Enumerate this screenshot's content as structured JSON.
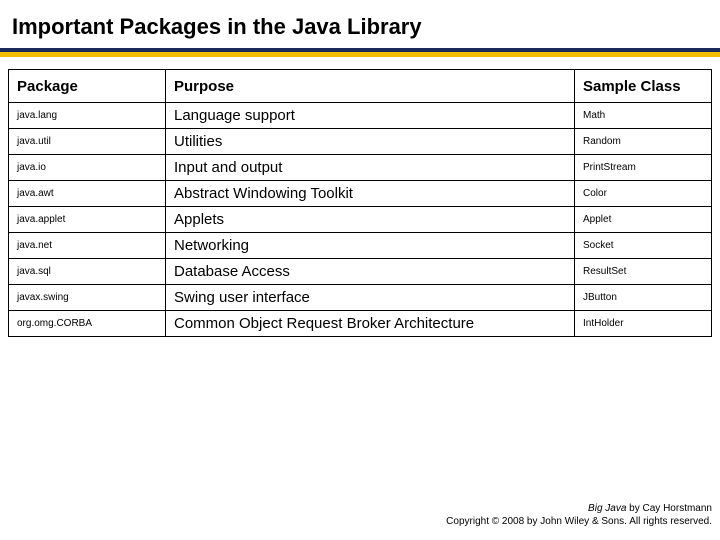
{
  "title": "Important Packages in the Java Library",
  "headers": {
    "package": "Package",
    "purpose": "Purpose",
    "sample": "Sample Class"
  },
  "rows": [
    {
      "pkg": "java.lang",
      "purpose": "Language support",
      "sample": "Math"
    },
    {
      "pkg": "java.util",
      "purpose": "Utilities",
      "sample": "Random"
    },
    {
      "pkg": "java.io",
      "purpose": "Input and output",
      "sample": "PrintStream"
    },
    {
      "pkg": "java.awt",
      "purpose": "Abstract Windowing Toolkit",
      "sample": "Color"
    },
    {
      "pkg": "java.applet",
      "purpose": "Applets",
      "sample": "Applet"
    },
    {
      "pkg": "java.net",
      "purpose": "Networking",
      "sample": "Socket"
    },
    {
      "pkg": "java.sql",
      "purpose": "Database Access",
      "sample": "ResultSet"
    },
    {
      "pkg": "javax.swing",
      "purpose": "Swing user interface",
      "sample": "JButton"
    },
    {
      "pkg": "org.omg.CORBA",
      "purpose": "Common Object Request Broker Architecture",
      "sample": "IntHolder"
    }
  ],
  "footer": {
    "book": "Big Java",
    "byline": " by Cay Horstmann",
    "copyright": "Copyright © 2008 by John Wiley & Sons. All rights reserved."
  }
}
